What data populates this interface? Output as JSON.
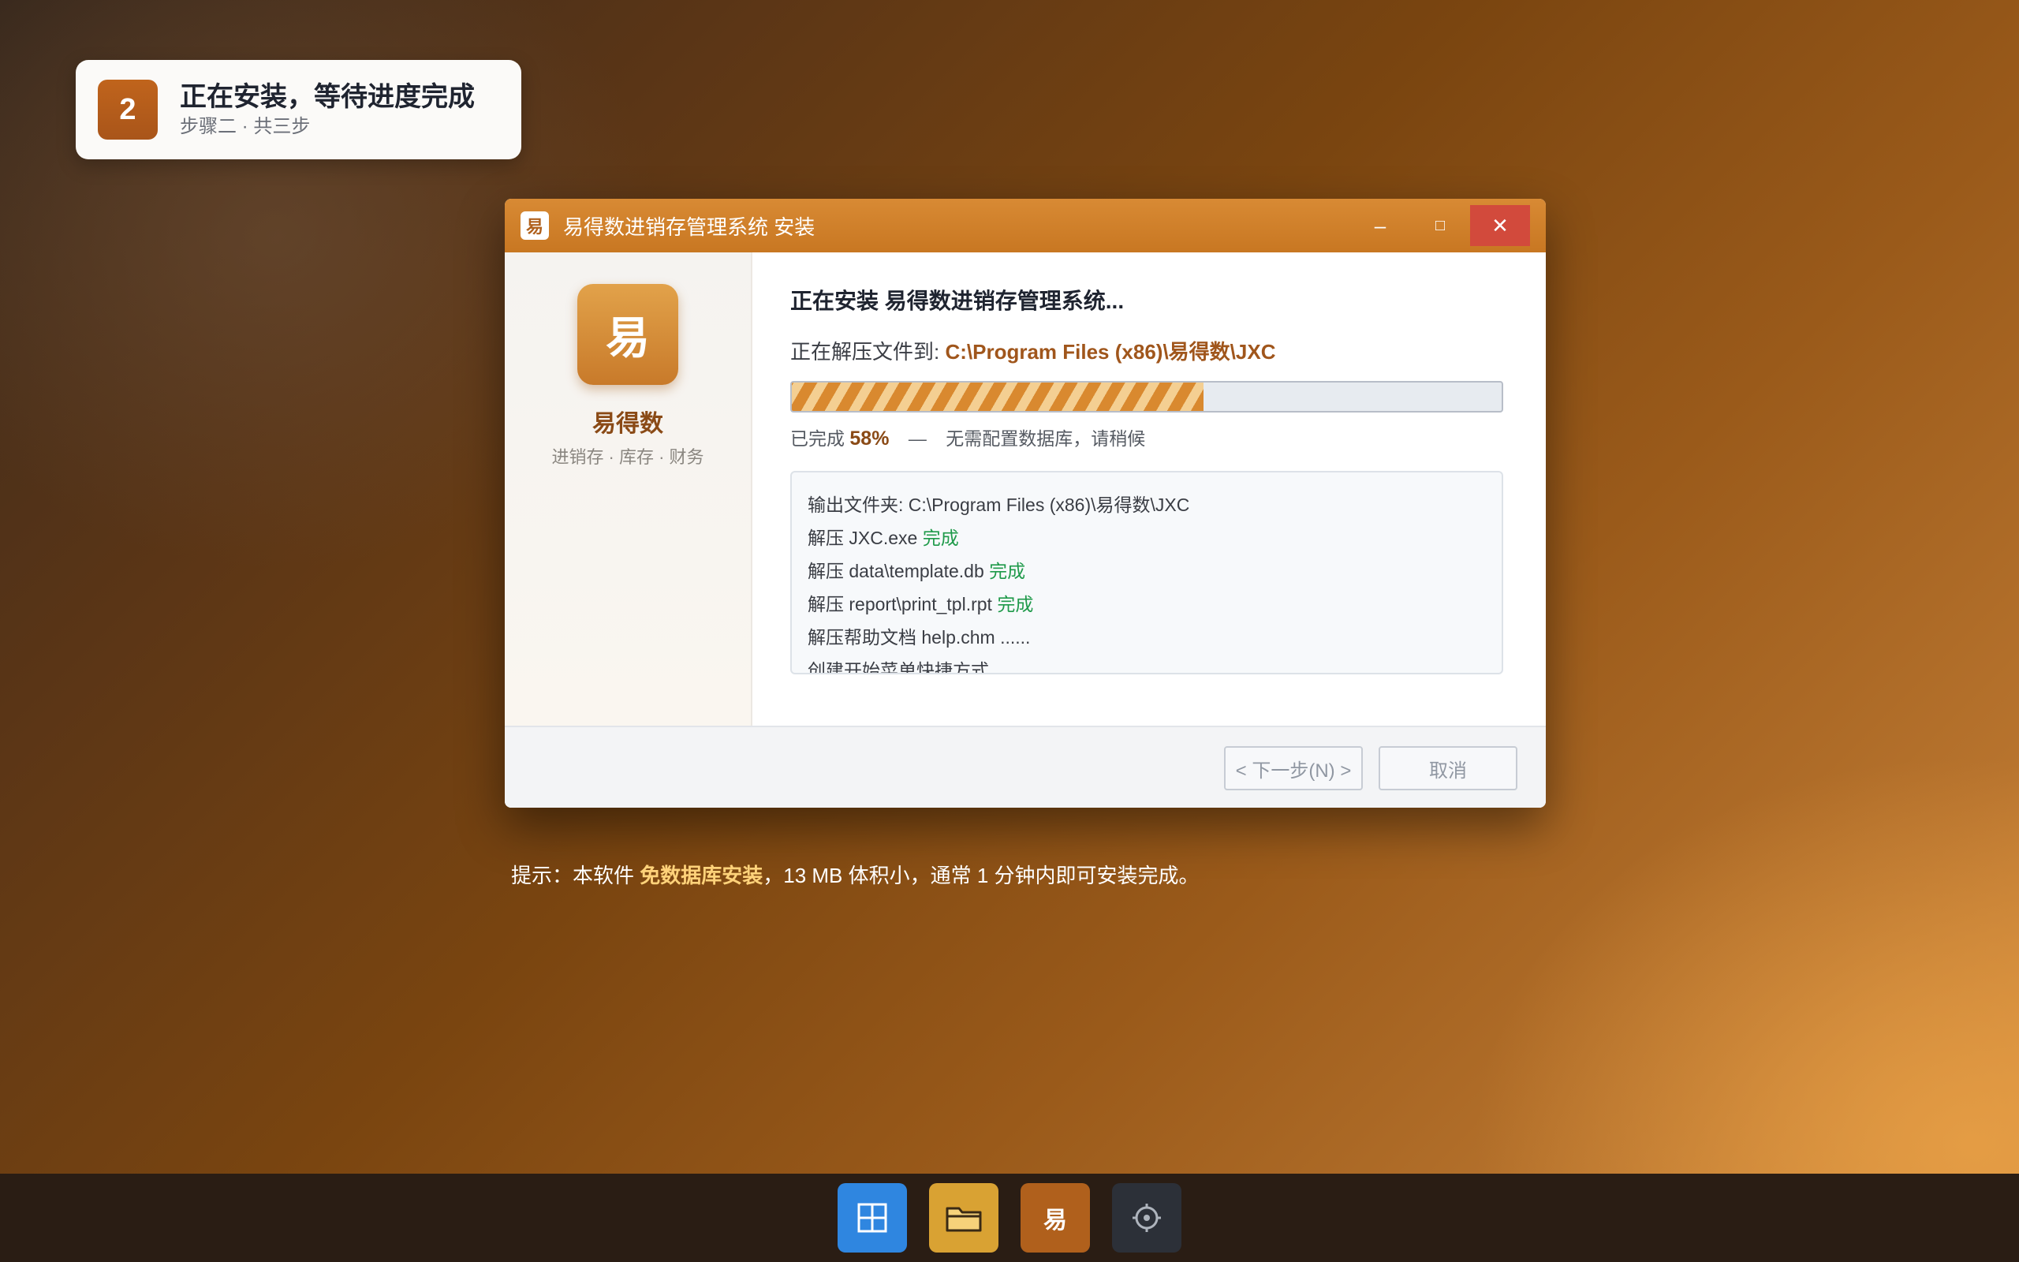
{
  "step": {
    "number": "2",
    "title": "正在安装，等待进度完成",
    "subtitle": "步骤二 · 共三步"
  },
  "window": {
    "icon_text": "易",
    "title": "易得数进销存管理系统 安装",
    "controls": {
      "minimize": "–",
      "maximize": "□",
      "close": "✕"
    }
  },
  "sidebar": {
    "logo_text": "易",
    "app_name": "易得数",
    "tagline": "进销存 · 库存 · 财务"
  },
  "main": {
    "heading": "正在安装 易得数进销存管理系统...",
    "path_label": "正在解压文件到:",
    "path_value": "C:\\Program Files (x86)\\易得数\\JXC",
    "progress": 0.58,
    "status_prefix": "已完成",
    "status_percent": "58%",
    "status_dash": "—",
    "status_note": "无需配置数据库，请稍候"
  },
  "log": [
    {
      "text": "输出文件夹: C:\\Program Files (x86)\\易得数\\JXC",
      "status": ""
    },
    {
      "text": "解压 JXC.exe ",
      "status": "完成"
    },
    {
      "text": "解压 data\\template.db ",
      "status": "完成"
    },
    {
      "text": "解压 report\\print_tpl.rpt ",
      "status": "完成"
    },
    {
      "text": "解压帮助文档 help.chm ......",
      "status": ""
    },
    {
      "text": "创建开始菜单快捷方式 ...",
      "status": ""
    }
  ],
  "footer": {
    "next_label": "< 下一步(N) >",
    "cancel_label": "取消"
  },
  "hint": {
    "prefix": "提示：本软件 ",
    "emphasis": "免数据库安装",
    "suffix": "，13 MB 体积小，通常 1 分钟内即可安装完成。"
  },
  "taskbar": {
    "start_icon": "start-icon",
    "folder_icon": "folder-icon",
    "app_icon_text": "易",
    "settings_icon": "settings-icon"
  },
  "colors": {
    "accent": "#c87722",
    "brand_text": "#8a4a16",
    "ok_green": "#1f9a4a",
    "close_red": "#d24a3c"
  }
}
